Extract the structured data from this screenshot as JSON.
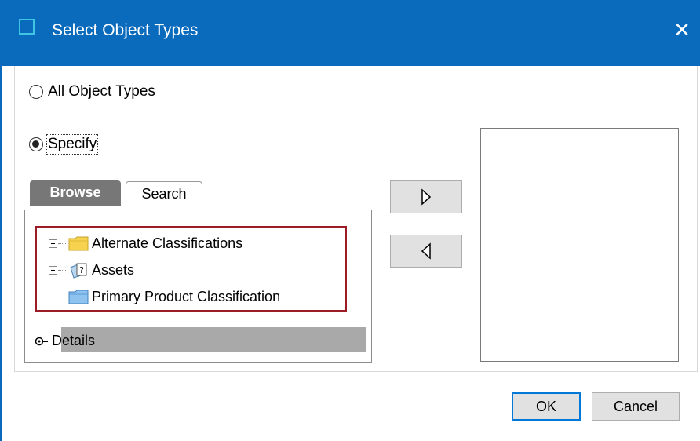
{
  "window": {
    "title": "Select Object Types",
    "close_glyph": "✕"
  },
  "options": {
    "all_object_types": "All Object Types",
    "specify": "Specify",
    "selected": "specify"
  },
  "tabs": [
    {
      "label": "Browse",
      "active": true
    },
    {
      "label": "Search",
      "active": false
    }
  ],
  "tree": {
    "items": [
      {
        "label": "Alternate Classifications",
        "icon": "folder-yellow-icon"
      },
      {
        "label": "Assets",
        "icon": "asset-document-icon"
      },
      {
        "label": "Primary Product Classification",
        "icon": "folder-blue-icon"
      }
    ]
  },
  "details": {
    "label": "Details"
  },
  "buttons": {
    "ok": "OK",
    "cancel": "Cancel"
  },
  "colors": {
    "titlebar": "#0a6bbd",
    "highlight": "#9b1c24",
    "ok_border": "#0078d7"
  }
}
